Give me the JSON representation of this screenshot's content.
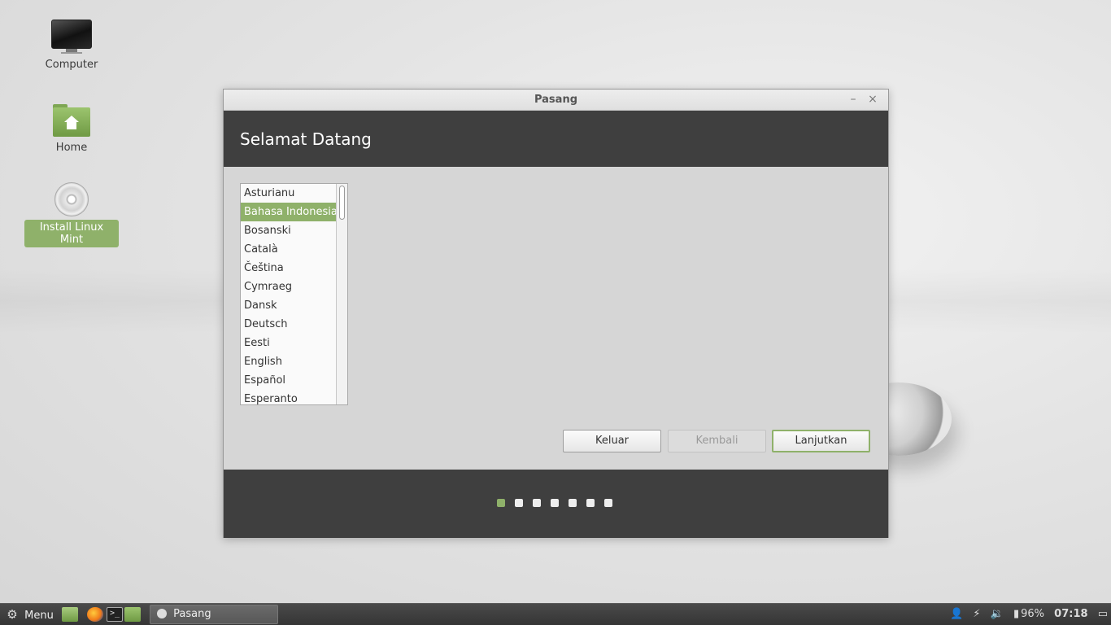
{
  "desktop": {
    "icons": [
      {
        "label": "Computer",
        "icon": "computer-icon"
      },
      {
        "label": "Home",
        "icon": "home-folder-icon"
      },
      {
        "label": "Install Linux Mint",
        "icon": "disc-icon"
      }
    ]
  },
  "window": {
    "title": "Pasang",
    "minimize_glyph": "–",
    "close_glyph": "×",
    "header": "Selamat Datang",
    "languages": [
      "Asturianu",
      "Bahasa Indonesia",
      "Bosanski",
      "Català",
      "Čeština",
      "Cymraeg",
      "Dansk",
      "Deutsch",
      "Eesti",
      "English",
      "Español",
      "Esperanto"
    ],
    "selected_language": "Bahasa Indonesia",
    "buttons": {
      "quit": "Keluar",
      "back": "Kembali",
      "next": "Lanjutkan"
    },
    "steps": {
      "total": 7,
      "current": 1
    }
  },
  "taskbar": {
    "menu_label": "Menu",
    "task_label": "Pasang",
    "battery": "96%",
    "time": "07:18"
  },
  "colors": {
    "accent": "#8fb16a",
    "header_bg": "#3f3f3f"
  }
}
